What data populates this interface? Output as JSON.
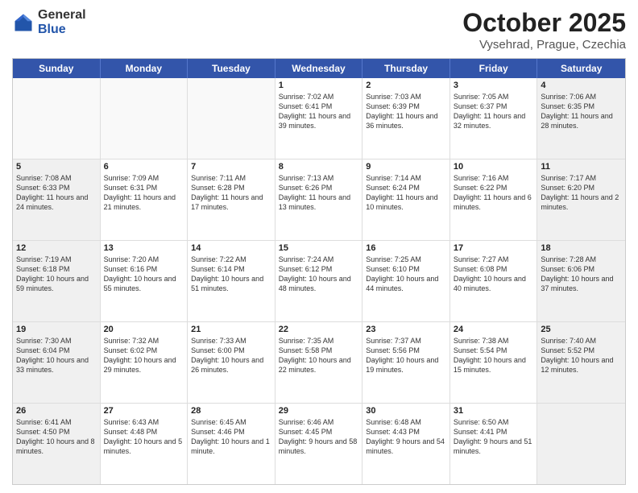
{
  "header": {
    "logo_general": "General",
    "logo_blue": "Blue",
    "month_title": "October 2025",
    "location": "Vysehrad, Prague, Czechia"
  },
  "days_of_week": [
    "Sunday",
    "Monday",
    "Tuesday",
    "Wednesday",
    "Thursday",
    "Friday",
    "Saturday"
  ],
  "weeks": [
    [
      {
        "day": "",
        "text": "",
        "shaded": false
      },
      {
        "day": "",
        "text": "",
        "shaded": false
      },
      {
        "day": "",
        "text": "",
        "shaded": false
      },
      {
        "day": "1",
        "text": "Sunrise: 7:02 AM\nSunset: 6:41 PM\nDaylight: 11 hours and 39 minutes.",
        "shaded": false
      },
      {
        "day": "2",
        "text": "Sunrise: 7:03 AM\nSunset: 6:39 PM\nDaylight: 11 hours and 36 minutes.",
        "shaded": false
      },
      {
        "day": "3",
        "text": "Sunrise: 7:05 AM\nSunset: 6:37 PM\nDaylight: 11 hours and 32 minutes.",
        "shaded": false
      },
      {
        "day": "4",
        "text": "Sunrise: 7:06 AM\nSunset: 6:35 PM\nDaylight: 11 hours and 28 minutes.",
        "shaded": true
      }
    ],
    [
      {
        "day": "5",
        "text": "Sunrise: 7:08 AM\nSunset: 6:33 PM\nDaylight: 11 hours and 24 minutes.",
        "shaded": true
      },
      {
        "day": "6",
        "text": "Sunrise: 7:09 AM\nSunset: 6:31 PM\nDaylight: 11 hours and 21 minutes.",
        "shaded": false
      },
      {
        "day": "7",
        "text": "Sunrise: 7:11 AM\nSunset: 6:28 PM\nDaylight: 11 hours and 17 minutes.",
        "shaded": false
      },
      {
        "day": "8",
        "text": "Sunrise: 7:13 AM\nSunset: 6:26 PM\nDaylight: 11 hours and 13 minutes.",
        "shaded": false
      },
      {
        "day": "9",
        "text": "Sunrise: 7:14 AM\nSunset: 6:24 PM\nDaylight: 11 hours and 10 minutes.",
        "shaded": false
      },
      {
        "day": "10",
        "text": "Sunrise: 7:16 AM\nSunset: 6:22 PM\nDaylight: 11 hours and 6 minutes.",
        "shaded": false
      },
      {
        "day": "11",
        "text": "Sunrise: 7:17 AM\nSunset: 6:20 PM\nDaylight: 11 hours and 2 minutes.",
        "shaded": true
      }
    ],
    [
      {
        "day": "12",
        "text": "Sunrise: 7:19 AM\nSunset: 6:18 PM\nDaylight: 10 hours and 59 minutes.",
        "shaded": true
      },
      {
        "day": "13",
        "text": "Sunrise: 7:20 AM\nSunset: 6:16 PM\nDaylight: 10 hours and 55 minutes.",
        "shaded": false
      },
      {
        "day": "14",
        "text": "Sunrise: 7:22 AM\nSunset: 6:14 PM\nDaylight: 10 hours and 51 minutes.",
        "shaded": false
      },
      {
        "day": "15",
        "text": "Sunrise: 7:24 AM\nSunset: 6:12 PM\nDaylight: 10 hours and 48 minutes.",
        "shaded": false
      },
      {
        "day": "16",
        "text": "Sunrise: 7:25 AM\nSunset: 6:10 PM\nDaylight: 10 hours and 44 minutes.",
        "shaded": false
      },
      {
        "day": "17",
        "text": "Sunrise: 7:27 AM\nSunset: 6:08 PM\nDaylight: 10 hours and 40 minutes.",
        "shaded": false
      },
      {
        "day": "18",
        "text": "Sunrise: 7:28 AM\nSunset: 6:06 PM\nDaylight: 10 hours and 37 minutes.",
        "shaded": true
      }
    ],
    [
      {
        "day": "19",
        "text": "Sunrise: 7:30 AM\nSunset: 6:04 PM\nDaylight: 10 hours and 33 minutes.",
        "shaded": true
      },
      {
        "day": "20",
        "text": "Sunrise: 7:32 AM\nSunset: 6:02 PM\nDaylight: 10 hours and 29 minutes.",
        "shaded": false
      },
      {
        "day": "21",
        "text": "Sunrise: 7:33 AM\nSunset: 6:00 PM\nDaylight: 10 hours and 26 minutes.",
        "shaded": false
      },
      {
        "day": "22",
        "text": "Sunrise: 7:35 AM\nSunset: 5:58 PM\nDaylight: 10 hours and 22 minutes.",
        "shaded": false
      },
      {
        "day": "23",
        "text": "Sunrise: 7:37 AM\nSunset: 5:56 PM\nDaylight: 10 hours and 19 minutes.",
        "shaded": false
      },
      {
        "day": "24",
        "text": "Sunrise: 7:38 AM\nSunset: 5:54 PM\nDaylight: 10 hours and 15 minutes.",
        "shaded": false
      },
      {
        "day": "25",
        "text": "Sunrise: 7:40 AM\nSunset: 5:52 PM\nDaylight: 10 hours and 12 minutes.",
        "shaded": true
      }
    ],
    [
      {
        "day": "26",
        "text": "Sunrise: 6:41 AM\nSunset: 4:50 PM\nDaylight: 10 hours and 8 minutes.",
        "shaded": true
      },
      {
        "day": "27",
        "text": "Sunrise: 6:43 AM\nSunset: 4:48 PM\nDaylight: 10 hours and 5 minutes.",
        "shaded": false
      },
      {
        "day": "28",
        "text": "Sunrise: 6:45 AM\nSunset: 4:46 PM\nDaylight: 10 hours and 1 minute.",
        "shaded": false
      },
      {
        "day": "29",
        "text": "Sunrise: 6:46 AM\nSunset: 4:45 PM\nDaylight: 9 hours and 58 minutes.",
        "shaded": false
      },
      {
        "day": "30",
        "text": "Sunrise: 6:48 AM\nSunset: 4:43 PM\nDaylight: 9 hours and 54 minutes.",
        "shaded": false
      },
      {
        "day": "31",
        "text": "Sunrise: 6:50 AM\nSunset: 4:41 PM\nDaylight: 9 hours and 51 minutes.",
        "shaded": false
      },
      {
        "day": "",
        "text": "",
        "shaded": true
      }
    ]
  ]
}
